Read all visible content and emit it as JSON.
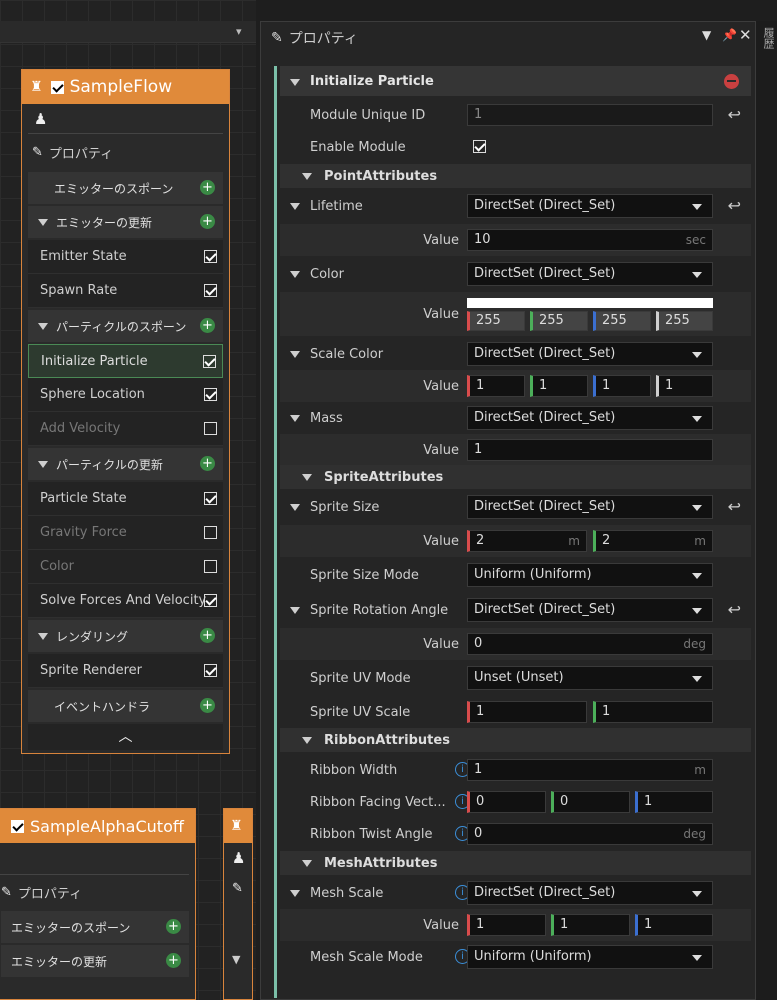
{
  "node1": {
    "title": "SampleFlow",
    "properties_label": "プロパティ",
    "sections": [
      {
        "type": "section",
        "label": "エミッターのスポーン",
        "expander": false
      },
      {
        "type": "section",
        "label": "エミッターの更新",
        "expander": true
      },
      {
        "type": "item",
        "label": "Emitter State",
        "checked": true
      },
      {
        "type": "item",
        "label": "Spawn Rate",
        "checked": true
      },
      {
        "type": "section",
        "label": "パーティクルのスポーン",
        "expander": true
      },
      {
        "type": "item",
        "label": "Initialize Particle",
        "checked": true,
        "selected": true
      },
      {
        "type": "item",
        "label": "Sphere Location",
        "checked": true
      },
      {
        "type": "item",
        "label": "Add Velocity",
        "checked": false,
        "disabled": true
      },
      {
        "type": "section",
        "label": "パーティクルの更新",
        "expander": true
      },
      {
        "type": "item",
        "label": "Particle State",
        "checked": true
      },
      {
        "type": "item",
        "label": "Gravity Force",
        "checked": false,
        "disabled": true
      },
      {
        "type": "item",
        "label": "Color",
        "checked": false,
        "disabled": true
      },
      {
        "type": "item",
        "label": "Solve Forces And Velocity",
        "checked": true
      },
      {
        "type": "section",
        "label": "レンダリング",
        "expander": true
      },
      {
        "type": "item",
        "label": "Sprite Renderer",
        "checked": true
      },
      {
        "type": "section",
        "label": "イベントハンドラ",
        "expander": false
      }
    ]
  },
  "node2": {
    "title": "SampleAlphaCutoff",
    "properties_label": "プロパティ",
    "sections": [
      "エミッターのスポーン",
      "エミッターの更新"
    ]
  },
  "panel": {
    "title": "プロパティ",
    "side_tab": "履歴",
    "module_title": "Initialize Particle",
    "module_id_label": "Module Unique ID",
    "module_id_value": "1",
    "enable_label": "Enable Module",
    "point_attrs": "PointAttributes",
    "sprite_attrs": "SpriteAttributes",
    "ribbon_attrs": "RibbonAttributes",
    "mesh_attrs": "MeshAttributes",
    "value_label": "Value",
    "direct_set": "DirectSet (Direct_Set)",
    "lifetime_label": "Lifetime",
    "lifetime_value": "10",
    "unit_sec": "sec",
    "color_label": "Color",
    "color_values": [
      "255",
      "255",
      "255",
      "255"
    ],
    "scale_color_label": "Scale Color",
    "scale_color_values": [
      "1",
      "1",
      "1",
      "1"
    ],
    "mass_label": "Mass",
    "mass_value": "1",
    "sprite_size_label": "Sprite Size",
    "sprite_size_values": [
      "2",
      "2"
    ],
    "unit_m": "m",
    "sprite_size_mode_label": "Sprite Size Mode",
    "uniform": "Uniform (Uniform)",
    "sprite_rot_label": "Sprite Rotation Angle",
    "sprite_rot_value": "0",
    "unit_deg": "deg",
    "sprite_uv_mode_label": "Sprite UV Mode",
    "unset": "Unset (Unset)",
    "sprite_uv_scale_label": "Sprite UV Scale",
    "sprite_uv_scale_values": [
      "1",
      "1"
    ],
    "ribbon_width_label": "Ribbon Width",
    "ribbon_width_value": "1",
    "ribbon_facing_label": "Ribbon Facing Vect...",
    "ribbon_facing_values": [
      "0",
      "0",
      "1"
    ],
    "ribbon_twist_label": "Ribbon Twist Angle",
    "ribbon_twist_value": "0",
    "mesh_scale_label": "Mesh Scale",
    "mesh_scale_values": [
      "1",
      "1",
      "1"
    ],
    "mesh_scale_mode_label": "Mesh Scale Mode"
  }
}
